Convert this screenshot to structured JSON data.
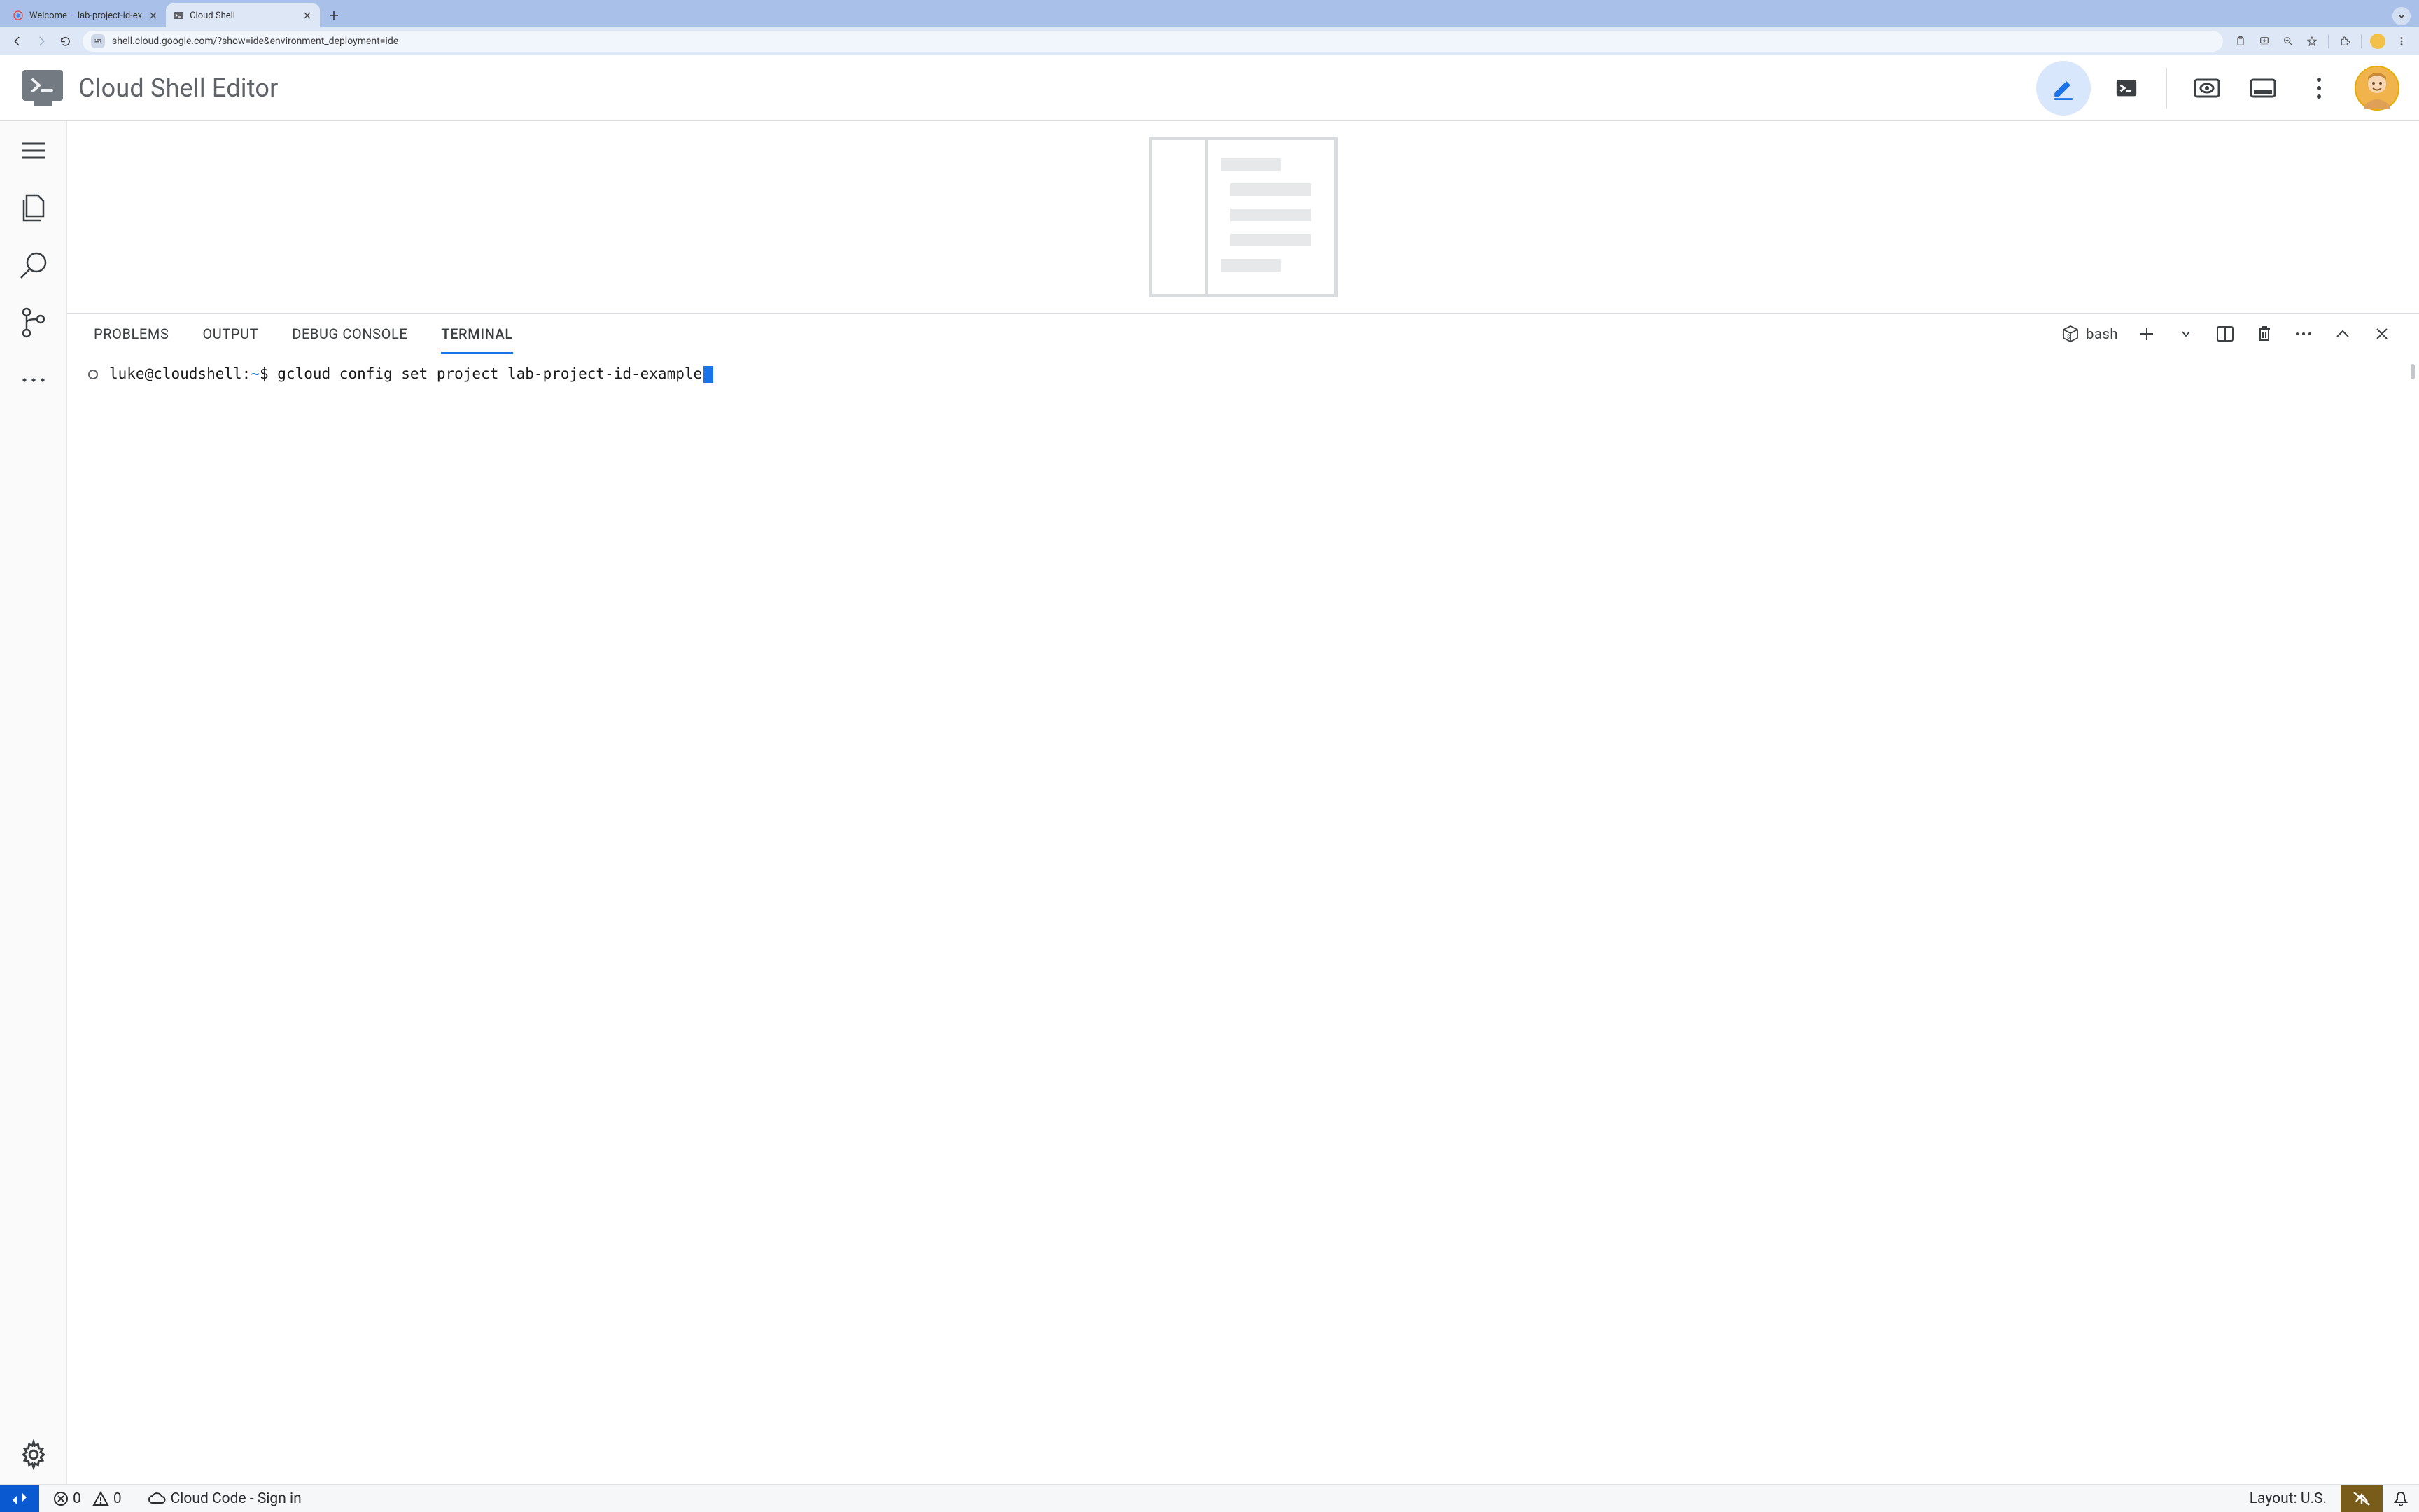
{
  "browser": {
    "tabs": [
      {
        "title": "Welcome – lab-project-id-ex",
        "active": false
      },
      {
        "title": "Cloud Shell",
        "active": true
      }
    ],
    "url": "shell.cloud.google.com/?show=ide&environment_deployment=ide"
  },
  "header": {
    "title": "Cloud Shell Editor"
  },
  "panel": {
    "tabs": {
      "problems": "PROBLEMS",
      "output": "OUTPUT",
      "debug": "DEBUG CONSOLE",
      "terminal": "TERMINAL"
    },
    "active_tab": "terminal",
    "shell_label": "bash"
  },
  "terminal": {
    "prompt_user": "luke@cloudshell",
    "prompt_path": "~",
    "prompt_symbol": "$",
    "command": "gcloud config set project lab-project-id-example"
  },
  "status": {
    "errors": "0",
    "warnings": "0",
    "cloud_code": "Cloud Code - Sign in",
    "layout": "Layout: U.S."
  }
}
